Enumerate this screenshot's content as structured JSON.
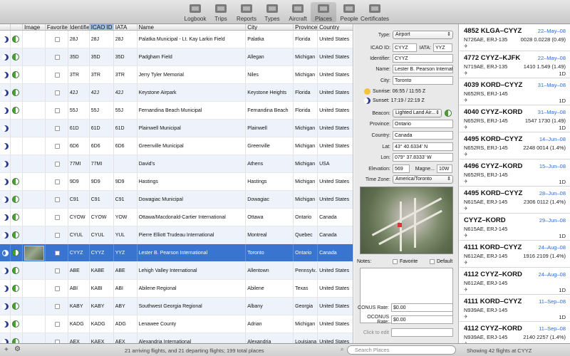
{
  "toolbar": {
    "items": [
      {
        "label": "Logbook",
        "icon": "logbook-icon"
      },
      {
        "label": "Trips",
        "icon": "trips-icon"
      },
      {
        "label": "Reports",
        "icon": "reports-icon"
      },
      {
        "label": "Types",
        "icon": "types-icon"
      },
      {
        "label": "Aircraft",
        "icon": "aircraft-icon"
      },
      {
        "label": "Places",
        "icon": "places-icon",
        "active": true
      },
      {
        "label": "People",
        "icon": "people-icon"
      },
      {
        "label": "Certificates",
        "icon": "certificates-icon"
      }
    ]
  },
  "grid": {
    "headers": [
      "",
      "",
      "Image",
      "Favorite",
      "Identifier",
      "ICAO ID",
      "IATA",
      "Name",
      "City",
      "Province",
      "Country"
    ],
    "sorted_header": "ICAO ID",
    "rows": [
      {
        "ident": "28J",
        "icao": "28J",
        "iata": "28J",
        "name": "Palatka Municipal - Lt. Kay Larkin Field",
        "city": "Palatka",
        "province": "Florida",
        "country": "United States",
        "day": true
      },
      {
        "ident": "35D",
        "icao": "35D",
        "iata": "35D",
        "name": "Padgham Field",
        "city": "Allegan",
        "province": "Michigan",
        "country": "United States",
        "day": true
      },
      {
        "ident": "3TR",
        "icao": "3TR",
        "iata": "3TR",
        "name": "Jerry Tyler Memorial",
        "city": "Niles",
        "province": "Michigan",
        "country": "United States",
        "day": true
      },
      {
        "ident": "42J",
        "icao": "42J",
        "iata": "42J",
        "name": "Keystone Airpark",
        "city": "Keystone Heights",
        "province": "Florida",
        "country": "United States",
        "day": true
      },
      {
        "ident": "55J",
        "icao": "55J",
        "iata": "55J",
        "name": "Fernandina Beach Municipal",
        "city": "Fernandina Beach",
        "province": "Florida",
        "country": "United States",
        "day": true
      },
      {
        "ident": "61D",
        "icao": "61D",
        "iata": "61D",
        "name": "Plainwell Municipal",
        "city": "Plainwell",
        "province": "Michigan",
        "country": "United States",
        "day": false
      },
      {
        "ident": "6D6",
        "icao": "6D6",
        "iata": "6D6",
        "name": "Greenville Municipal",
        "city": "Greenville",
        "province": "Michigan",
        "country": "United States",
        "day": false
      },
      {
        "ident": "77MI",
        "icao": "77MI",
        "iata": "",
        "name": "David's",
        "city": "Athens",
        "province": "Michigan",
        "country": "USA",
        "day": false
      },
      {
        "ident": "9D9",
        "icao": "9D9",
        "iata": "9D9",
        "name": "Hastings",
        "city": "Hastings",
        "province": "Michigan",
        "country": "United States",
        "day": true
      },
      {
        "ident": "C91",
        "icao": "C91",
        "iata": "C91",
        "name": "Dowagiac Municipal",
        "city": "Dowagiac",
        "province": "Michigan",
        "country": "United States",
        "day": true
      },
      {
        "ident": "CYOW",
        "icao": "CYOW",
        "iata": "YOW",
        "name": "Ottawa/Macdonald-Cartier International",
        "city": "Ottawa",
        "province": "Ontario",
        "country": "Canada",
        "day": true
      },
      {
        "ident": "CYUL",
        "icao": "CYUL",
        "iata": "YUL",
        "name": "Pierre Elliott Trudeau International",
        "city": "Montreal",
        "province": "Quebec",
        "country": "Canada",
        "day": true
      },
      {
        "ident": "CYYZ",
        "icao": "CYYZ",
        "iata": "YYZ",
        "name": "Lester B. Pearson International",
        "city": "Toronto",
        "province": "Ontario",
        "country": "Canada",
        "day": true,
        "selected": true,
        "image": true
      },
      {
        "ident": "ABE",
        "icao": "KABE",
        "iata": "ABE",
        "name": "Lehigh Valley International",
        "city": "Allentown",
        "province": "Pennsylv...",
        "country": "United States",
        "day": true
      },
      {
        "ident": "ABI",
        "icao": "KABI",
        "iata": "ABI",
        "name": "Abilene Regional",
        "city": "Abilene",
        "province": "Texas",
        "country": "United States",
        "day": true
      },
      {
        "ident": "KABY",
        "icao": "KABY",
        "iata": "ABY",
        "name": "Southwest Georgia Regional",
        "city": "Albany",
        "province": "Georgia",
        "country": "United States",
        "day": true
      },
      {
        "ident": "KADG",
        "icao": "KADG",
        "iata": "ADG",
        "name": "Lenawee County",
        "city": "Adrian",
        "province": "Michigan",
        "country": "United States",
        "day": true
      },
      {
        "ident": "AEX",
        "icao": "KAEX",
        "iata": "AEX",
        "name": "Alexandria International",
        "city": "Alexandria",
        "province": "Louisiana",
        "country": "United States",
        "day": true
      }
    ]
  },
  "detail": {
    "type_label": "Type:",
    "type_value": "Airport",
    "icao_label": "ICAO ID:",
    "icao_value": "CYYZ",
    "iata_label": "IATA:",
    "iata_value": "YYZ",
    "identifier_label": "Identifier:",
    "identifier_value": "CYYZ",
    "name_label": "Name:",
    "name_value": "Lester B. Pearson Internatio",
    "city_label": "City:",
    "city_value": "Toronto",
    "sunrise": "Sunrise: 06:55 / 11:55 Z",
    "sunset": "Sunset: 17:19 / 22:19 Z",
    "beacon_label": "Beacon:",
    "beacon_value": "Lighted Land Air...",
    "province_label": "Province:",
    "province_value": "Ontario",
    "country_label": "Country:",
    "country_value": "Canada",
    "lat_label": "Lat:",
    "lat_value": "43° 40.6334' N",
    "lon_label": "Lon:",
    "lon_value": "079° 37.8333' W",
    "elev_label": "Elevation:",
    "elev_value": "569",
    "magne_label": "Magne...",
    "magne_value": "10W",
    "tz_label": "Time Zone:",
    "tz_value": "America/Toronto",
    "notes_label": "Notes:",
    "favorite_label": "Favorite",
    "default_label": "Default",
    "conus_label": "CONUS Rate:",
    "conus_value": "$0.00",
    "oconus_label": "OCONUS Rate:",
    "oconus_value": "$0.00",
    "edit_placeholder": "Click to edit"
  },
  "flights": [
    {
      "route": "4852 KLGA–CYYZ",
      "date": "22–May–08",
      "aircraft": "N726AE, ERJ-135",
      "time": "0028 0.0228 (0.49)",
      "type": ""
    },
    {
      "route": "4772 CYYZ–KJFK",
      "date": "22–May–08",
      "aircraft": "N719AE, ERJ-135",
      "time": "1410 1.549 (1.49)",
      "type": "1D"
    },
    {
      "route": "4039 KORD–CYYZ",
      "date": "31–May–08",
      "aircraft": "N652RS, ERJ-145",
      "time": "",
      "type": "1D"
    },
    {
      "route": "4040 CYYZ–KORD",
      "date": "31–May–08",
      "aircraft": "N652RS, ERJ-145",
      "time": "1547 1730 (1.49)",
      "type": "1D"
    },
    {
      "route": "4495 KORD–CYYZ",
      "date": "14–Jun–08",
      "aircraft": "N652RS, ERJ-145",
      "time": "2248 0014 (1.4%)",
      "type": ""
    },
    {
      "route": "4496 CYYZ–KORD",
      "date": "15–Jun–08",
      "aircraft": "N652RS, ERJ-145",
      "time": "",
      "type": "1D"
    },
    {
      "route": "4495 KORD–CYYZ",
      "date": "28–Jun–08",
      "aircraft": "N615AE, ERJ-145",
      "time": "2306 0112 (1.4%)",
      "type": ""
    },
    {
      "route": "CYYZ–KORD",
      "date": "29–Jun–08",
      "aircraft": "N615AE, ERJ-145",
      "time": "",
      "type": "1D"
    },
    {
      "route": "4111 KORD–CYYZ",
      "date": "24–Aug–08",
      "aircraft": "N612AE, ERJ-145",
      "time": "1916 2109 (1.4%)",
      "type": ""
    },
    {
      "route": "4112 CYYZ–KORD",
      "date": "24–Aug–08",
      "aircraft": "N612AE, ERJ-145",
      "time": "",
      "type": "1D"
    },
    {
      "route": "4111 KORD–CYYZ",
      "date": "11–Sep–08",
      "aircraft": "N939AE, ERJ-145",
      "time": "",
      "type": "1D"
    },
    {
      "route": "4112 CYYZ–KORD",
      "date": "11–Sep–08",
      "aircraft": "N939AE, ERJ-145",
      "time": "2140 2257 (1.4%)",
      "type": ""
    }
  ],
  "status": {
    "summary": "21 arriving flights, and 21 departing flights; 199 total places",
    "search_placeholder": "Search Places",
    "right": "Showing 42 flights at CYYZ"
  },
  "colors": {
    "selection": "#3874d0",
    "date": "#2f6bd3"
  }
}
